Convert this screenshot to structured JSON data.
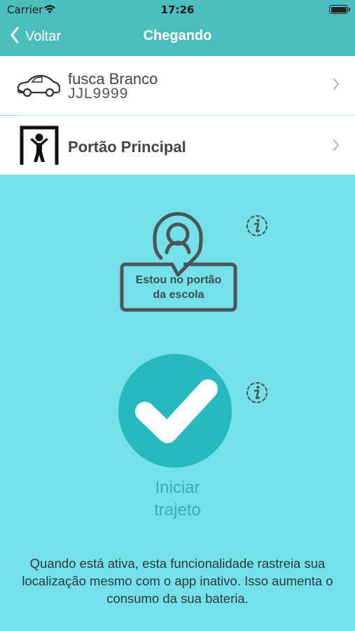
{
  "status_bar": {
    "carrier": "Carrier",
    "time": "17:26"
  },
  "nav": {
    "back_label": "Voltar",
    "title": "Chegando"
  },
  "vehicle": {
    "name": "fusca Branco",
    "plate": "JJL9999",
    "icon": "car-icon"
  },
  "gate": {
    "name": "Portão Principal",
    "icon": "gate-person-icon"
  },
  "location_button": {
    "label_line1": "Estou no portão",
    "label_line2": "da escola"
  },
  "start_button": {
    "label_line1": "Iniciar",
    "label_line2": "trajeto"
  },
  "footer": {
    "message": "Quando está ativa, esta funcionalidade rastreia sua localização mesmo com o app inativo. Isso aumenta o consumo da sua bateria."
  },
  "colors": {
    "header": "#4bbdbf",
    "background": "#74e1ea",
    "check_circle": "#26b9bd",
    "start_label": "#3fa9b5"
  }
}
